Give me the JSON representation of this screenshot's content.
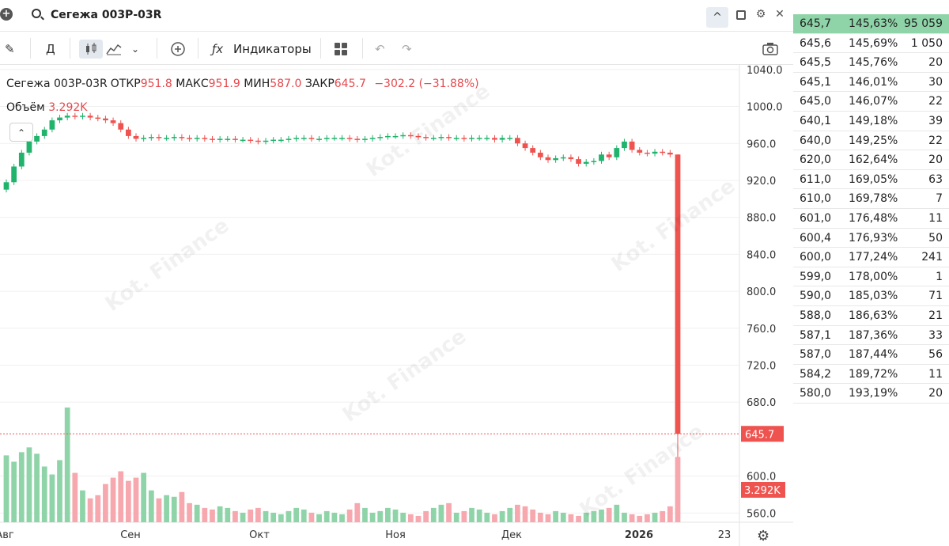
{
  "header": {
    "search_value": "Сегежа 003Р-03R",
    "add_icon": "plus-icon",
    "collapse_icon": "chevron-up-icon",
    "window_icons": [
      "maximize-icon",
      "gear-icon",
      "close-icon"
    ]
  },
  "toolbar": {
    "period": "Д",
    "indicators_label": "Индикаторы",
    "icons": [
      "pencil-icon",
      "candles-icon",
      "area-chart-icon",
      "chevron-down-icon",
      "add-circle-icon",
      "fx-icon",
      "layout-grid-icon",
      "undo-icon",
      "redo-icon",
      "camera-icon"
    ]
  },
  "legend": {
    "name": "Сегежа 003Р-03R",
    "open_label": "ОТКР",
    "open": "951.8",
    "high_label": "МАКС",
    "high": "951.9",
    "low_label": "МИН",
    "low": "587.0",
    "close_label": "ЗАКР",
    "close": "645.7",
    "change": "−302.2 (−31.88%)",
    "volume_label": "Объём",
    "volume": "3.292K"
  },
  "colors": {
    "up": "#26a69a",
    "up_volume": "#8fd4a8",
    "down": "#ef5350",
    "down_volume": "#f7a8ae",
    "price_marker": "#ef5350",
    "grid": "#f0f0f0",
    "orderbook_highlight": "#8fd4a8"
  },
  "price_axis": {
    "ticks": [
      "1040.0",
      "1000.0",
      "960.0",
      "920.0",
      "880.0",
      "840.0",
      "800.0",
      "760.0",
      "720.0",
      "680.0",
      "600.0",
      "560.0"
    ],
    "last_price_label": "645.7",
    "volume_label": "3.292K"
  },
  "time_axis": {
    "ticks": [
      "Авг",
      "Сен",
      "Окт",
      "Ноя",
      "Дек",
      "2026",
      "23"
    ]
  },
  "chart_data": {
    "type": "candlestick",
    "title": "",
    "ylim": [
      550,
      1045
    ],
    "last_close": 645.7,
    "closes": [
      918,
      935,
      950,
      962,
      968,
      975,
      985,
      988,
      990,
      989,
      990,
      988,
      987,
      985,
      982,
      975,
      968,
      965,
      966,
      967,
      966,
      966,
      967,
      966,
      965,
      966,
      965,
      964,
      965,
      965,
      964,
      964,
      963,
      962,
      963,
      964,
      964,
      965,
      966,
      966,
      965,
      965,
      966,
      966,
      966,
      965,
      964,
      965,
      966,
      967,
      968,
      968,
      969,
      968,
      967,
      966,
      966,
      967,
      966,
      966,
      965,
      966,
      966,
      966,
      964,
      966,
      966,
      960,
      955,
      950,
      945,
      942,
      944,
      945,
      943,
      938,
      940,
      941,
      948,
      945,
      955,
      962,
      953,
      950,
      949,
      951,
      950,
      948,
      645.7
    ],
    "volumes": [
      420,
      380,
      440,
      470,
      430,
      350,
      300,
      390,
      720,
      310,
      200,
      150,
      170,
      240,
      280,
      320,
      260,
      280,
      310,
      200,
      150,
      170,
      160,
      190,
      120,
      110,
      90,
      80,
      100,
      90,
      70,
      60,
      80,
      90,
      70,
      60,
      50,
      70,
      90,
      80,
      60,
      50,
      70,
      60,
      50,
      80,
      120,
      90,
      60,
      70,
      90,
      80,
      60,
      50,
      40,
      70,
      90,
      110,
      120,
      60,
      70,
      90,
      80,
      60,
      50,
      70,
      90,
      110,
      100,
      80,
      60,
      50,
      70,
      60,
      50,
      40,
      60,
      70,
      80,
      90,
      110,
      60,
      50,
      40,
      50,
      60,
      70,
      100,
      410
    ],
    "dates_ticks": [
      "Авг",
      "Сен",
      "Окт",
      "Ноя",
      "Дек",
      "2026",
      "23"
    ]
  },
  "orderbook": [
    {
      "price": "645,7",
      "yield": "145,63%",
      "qty": "95 059",
      "highlight": true
    },
    {
      "price": "645,6",
      "yield": "145,69%",
      "qty": "1 050"
    },
    {
      "price": "645,5",
      "yield": "145,76%",
      "qty": "20"
    },
    {
      "price": "645,1",
      "yield": "146,01%",
      "qty": "30"
    },
    {
      "price": "645,0",
      "yield": "146,07%",
      "qty": "22"
    },
    {
      "price": "640,1",
      "yield": "149,18%",
      "qty": "39"
    },
    {
      "price": "640,0",
      "yield": "149,25%",
      "qty": "22"
    },
    {
      "price": "620,0",
      "yield": "162,64%",
      "qty": "20"
    },
    {
      "price": "611,0",
      "yield": "169,05%",
      "qty": "63"
    },
    {
      "price": "610,0",
      "yield": "169,78%",
      "qty": "7"
    },
    {
      "price": "601,0",
      "yield": "176,48%",
      "qty": "11"
    },
    {
      "price": "600,4",
      "yield": "176,93%",
      "qty": "50"
    },
    {
      "price": "600,0",
      "yield": "177,24%",
      "qty": "241"
    },
    {
      "price": "599,0",
      "yield": "178,00%",
      "qty": "1"
    },
    {
      "price": "590,0",
      "yield": "185,03%",
      "qty": "71"
    },
    {
      "price": "588,0",
      "yield": "186,63%",
      "qty": "21"
    },
    {
      "price": "587,1",
      "yield": "187,36%",
      "qty": "33"
    },
    {
      "price": "587,0",
      "yield": "187,44%",
      "qty": "56"
    },
    {
      "price": "584,2",
      "yield": "189,72%",
      "qty": "11"
    },
    {
      "price": "580,0",
      "yield": "193,19%",
      "qty": "20"
    }
  ],
  "watermark": "Kot. Finance"
}
